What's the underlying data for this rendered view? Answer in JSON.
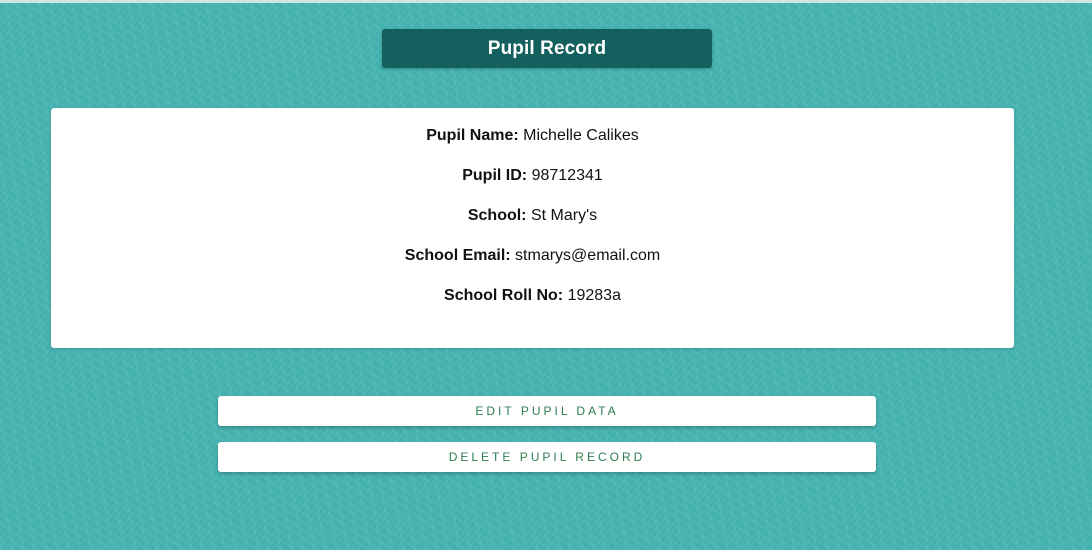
{
  "header": {
    "title": "Pupil Record"
  },
  "record": {
    "name_label": "Pupil Name:",
    "name_value": "Michelle Calikes",
    "id_label": "Pupil ID:",
    "id_value": "98712341",
    "school_label": "School:",
    "school_value": "St Mary's",
    "email_label": "School Email:",
    "email_value": "stmarys@email.com",
    "roll_label": "School Roll No:",
    "roll_value": "19283a"
  },
  "actions": {
    "edit_label": "EDIT PUPIL DATA",
    "delete_label": "DELETE PUPIL RECORD"
  },
  "colors": {
    "background": "#45b3b0",
    "title_bar": "#13605e",
    "button_text": "#2e7d4f"
  }
}
